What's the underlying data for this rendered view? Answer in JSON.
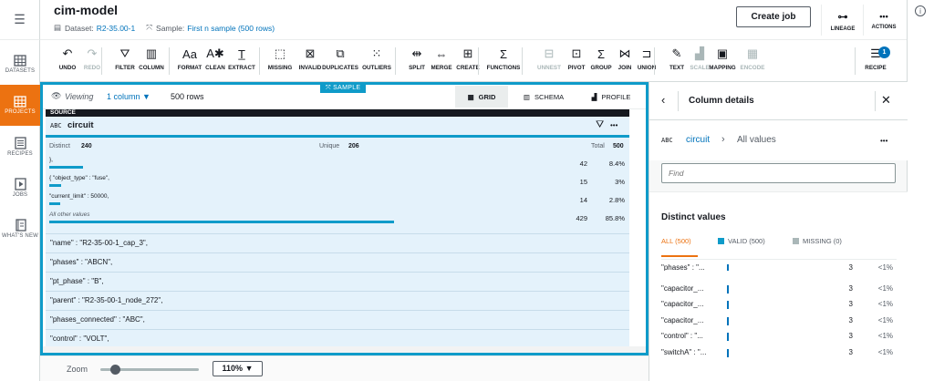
{
  "nav": {
    "items": [
      {
        "label": "DATASETS",
        "icon": "table-icon"
      },
      {
        "label": "PROJECTS",
        "icon": "grid-icon",
        "active": true
      },
      {
        "label": "RECIPES",
        "icon": "list-icon"
      },
      {
        "label": "JOBS",
        "icon": "play-icon"
      },
      {
        "label": "WHAT'S NEW",
        "icon": "book-icon"
      }
    ]
  },
  "header": {
    "title": "cim-model",
    "dataset_label": "Dataset:",
    "dataset_value": "R2-35.00-1",
    "sample_label": "Sample:",
    "sample_value": "First n sample (500 rows)",
    "create_job": "Create job",
    "lineage": "LINEAGE",
    "actions": "ACTIONS",
    "actions_glyph": "•••"
  },
  "toolbar": {
    "items": [
      {
        "label": "UNDO",
        "glyph": "↶"
      },
      {
        "label": "REDO",
        "glyph": "↷",
        "disabled": true
      },
      {
        "label": "FILTER",
        "glyph": "⛛"
      },
      {
        "label": "COLUMN",
        "glyph": "▥"
      },
      {
        "label": "FORMAT",
        "glyph": "Aa"
      },
      {
        "label": "CLEAN",
        "glyph": "A✱"
      },
      {
        "label": "EXTRACT",
        "glyph": "T̲"
      },
      {
        "label": "MISSING",
        "glyph": "⬚"
      },
      {
        "label": "INVALID",
        "glyph": "⊠"
      },
      {
        "label": "DUPLICATES",
        "glyph": "⧉"
      },
      {
        "label": "OUTLIERS",
        "glyph": "⁙"
      },
      {
        "label": "SPLIT",
        "glyph": "⇹"
      },
      {
        "label": "MERGE",
        "glyph": "⇔"
      },
      {
        "label": "CREATE",
        "glyph": "⊞"
      },
      {
        "label": "FUNCTIONS",
        "glyph": "Σ"
      },
      {
        "label": "UNNEST",
        "glyph": "⊟",
        "disabled": true
      },
      {
        "label": "PIVOT",
        "glyph": "⊡"
      },
      {
        "label": "GROUP",
        "glyph": "Σ"
      },
      {
        "label": "JOIN",
        "glyph": "⋈"
      },
      {
        "label": "UNION",
        "glyph": "⊐"
      },
      {
        "label": "TEXT",
        "glyph": "✎"
      },
      {
        "label": "SCALE",
        "glyph": "▟",
        "disabled": true
      },
      {
        "label": "MAPPING",
        "glyph": "▣"
      },
      {
        "label": "ENCODE",
        "glyph": "▦",
        "disabled": true
      },
      {
        "label": "RECIPE",
        "glyph": "☰"
      }
    ],
    "recipe_badge": "1"
  },
  "viewbar": {
    "viewing": "Viewing",
    "columns": "1 column",
    "rows": "500 rows",
    "sample_tag": "SAMPLE",
    "tabs": [
      "GRID",
      "SCHEMA",
      "PROFILE"
    ]
  },
  "column": {
    "source_label": "SOURCE",
    "type": "ABC",
    "name": "circuit",
    "more": "•••",
    "distinct_label": "Distinct",
    "distinct": "240",
    "unique_label": "Unique",
    "unique": "206",
    "total_label": "Total",
    "total": "500",
    "values": [
      {
        "label": "},",
        "count": "42",
        "pct": "8.4%",
        "frac": 0.084
      },
      {
        "label": "{ \"object_type\" : \"fuse\",",
        "count": "15",
        "pct": "3%",
        "frac": 0.03
      },
      {
        "label": "\"current_limit\" : 50000,",
        "count": "14",
        "pct": "2.8%",
        "frac": 0.028
      },
      {
        "label": "All other values",
        "count": "429",
        "pct": "85.8%",
        "frac": 0.858,
        "italic": true
      }
    ],
    "cells": [
      "\"name\" : \"R2-35-00-1_cap_3\",",
      "\"phases\" : \"ABCN\",",
      "\"pt_phase\" : \"B\",",
      "\"parent\" : \"R2-35-00-1_node_272\",",
      "\"phases_connected\" : \"ABC\",",
      "\"control\" : \"VOLT\","
    ]
  },
  "bottom": {
    "zoom_label": "Zoom",
    "zoom_level": 0.1,
    "zoom_value": "110%"
  },
  "panel": {
    "title": "Column details",
    "type": "ABC",
    "column": "circuit",
    "crumb": "All values",
    "more": "•••",
    "find_placeholder": "Find",
    "distinct_title": "Distinct values",
    "tab_all": "ALL (500)",
    "tab_valid": "VALID (500)",
    "tab_missing": "MISSING (0)",
    "rows": [
      {
        "label": "\"phases\" : \"...",
        "count": "3",
        "pct": "<1%"
      },
      {
        "label": "\"capacitor_...",
        "count": "3",
        "pct": "<1%"
      },
      {
        "label": "\"capacitor_...",
        "count": "3",
        "pct": "<1%"
      },
      {
        "label": "\"capacitor_...",
        "count": "3",
        "pct": "<1%"
      },
      {
        "label": "\"control\" : \"...",
        "count": "3",
        "pct": "<1%"
      },
      {
        "label": "\"switchA\" : \"...",
        "count": "3",
        "pct": "<1%"
      }
    ]
  },
  "colors": {
    "accent": "#0f9bc9",
    "active_nav": "#ec7211",
    "link": "#0073bb"
  }
}
